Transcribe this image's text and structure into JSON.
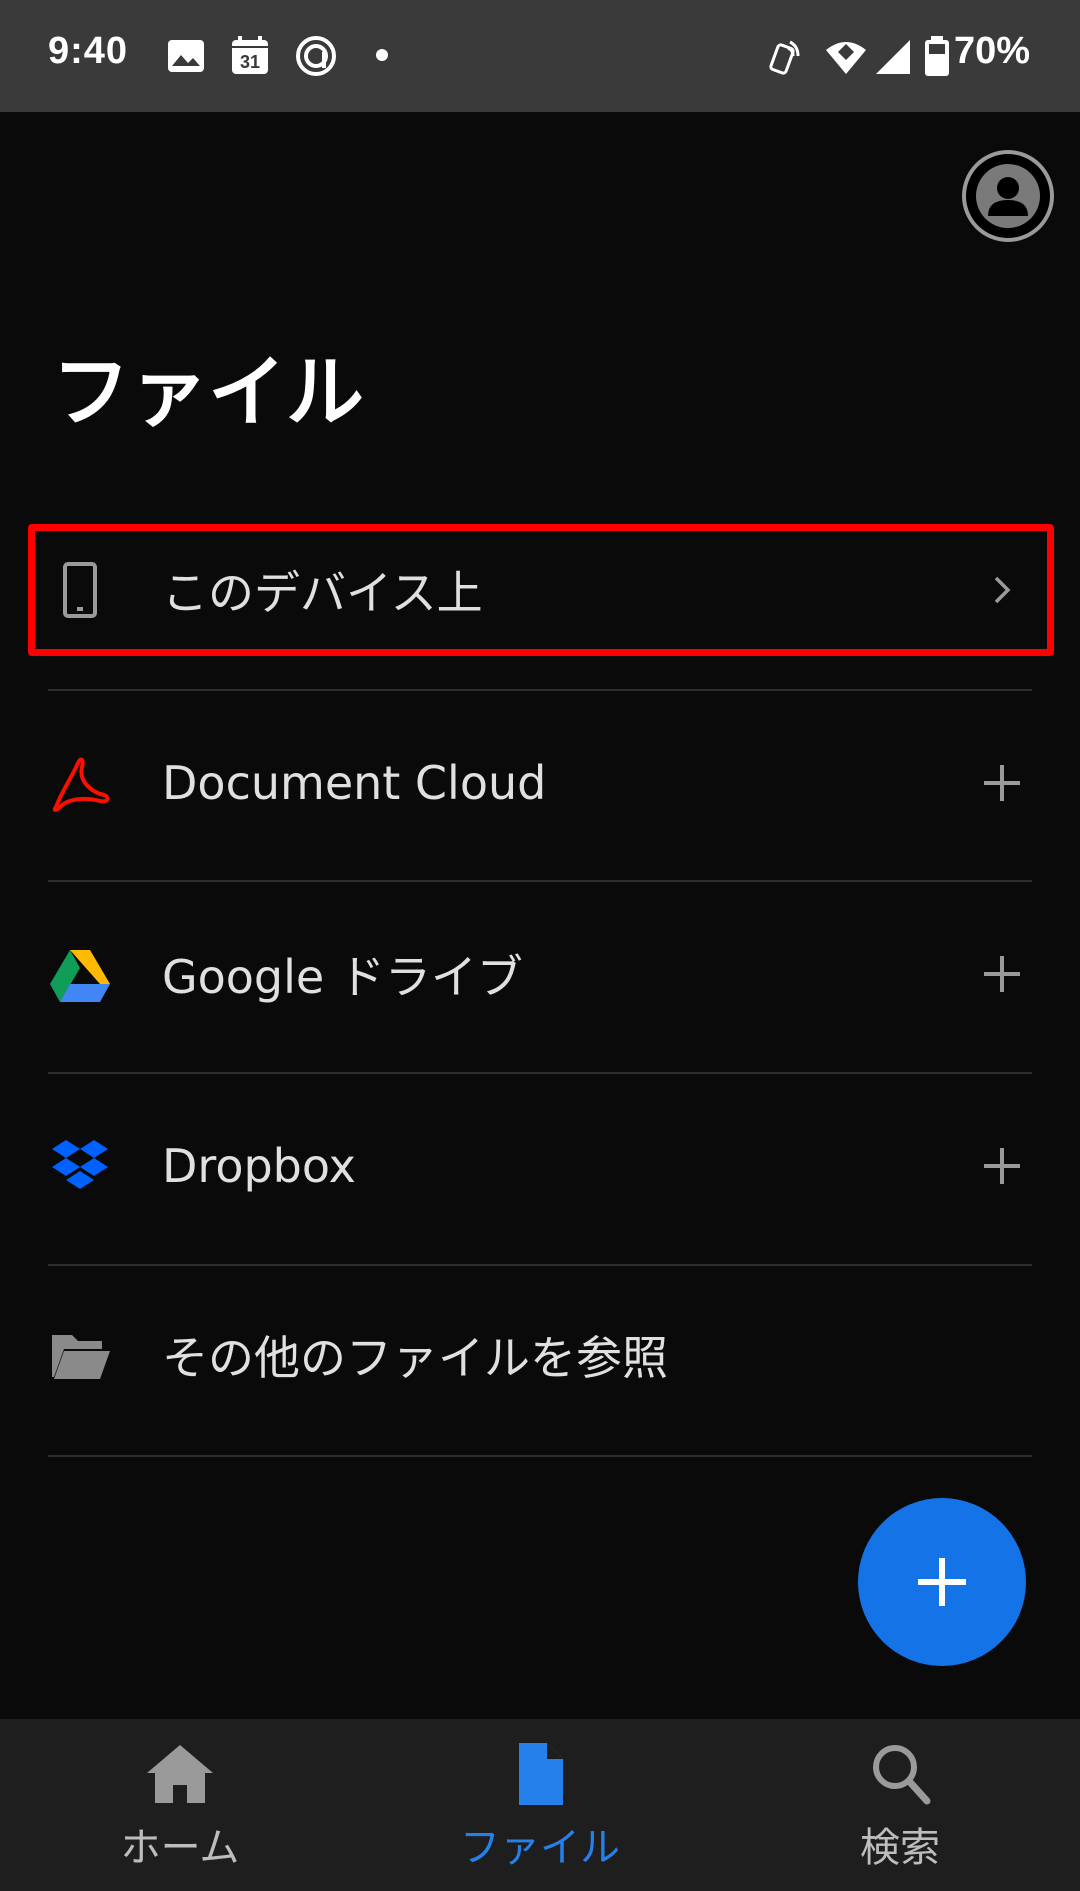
{
  "status_bar": {
    "time": "9:40",
    "battery": "70%",
    "icons": [
      "image-icon",
      "calendar-icon",
      "threads-icon",
      "nfc-icon",
      "wifi-icon",
      "signal-icon",
      "battery-icon"
    ],
    "calendar_day": "31"
  },
  "header": {
    "title": "ファイル",
    "avatar_icon": "account-icon"
  },
  "list": {
    "items": [
      {
        "label": "このデバイス上",
        "icon": "phone-icon",
        "action": "chevron-right-icon"
      },
      {
        "label": "Document Cloud",
        "icon": "acrobat-icon",
        "action": "plus-icon"
      },
      {
        "label": "Google ドライブ",
        "icon": "google-drive-icon",
        "action": "plus-icon"
      },
      {
        "label": "Dropbox",
        "icon": "dropbox-icon",
        "action": "plus-icon"
      },
      {
        "label": "その他のファイルを参照",
        "icon": "folder-icon",
        "action": ""
      }
    ]
  },
  "fab": {
    "icon": "plus-icon"
  },
  "bottom_nav": {
    "items": [
      {
        "label": "ホーム",
        "icon": "home-icon",
        "active": false
      },
      {
        "label": "ファイル",
        "icon": "file-icon",
        "active": true
      },
      {
        "label": "検索",
        "icon": "search-icon",
        "active": false
      }
    ]
  },
  "colors": {
    "accent": "#1473e6",
    "active_nav": "#2680eb",
    "highlight": "#ff0000",
    "acrobat_red": "#fa0f00",
    "dropbox_blue": "#0061fe"
  }
}
